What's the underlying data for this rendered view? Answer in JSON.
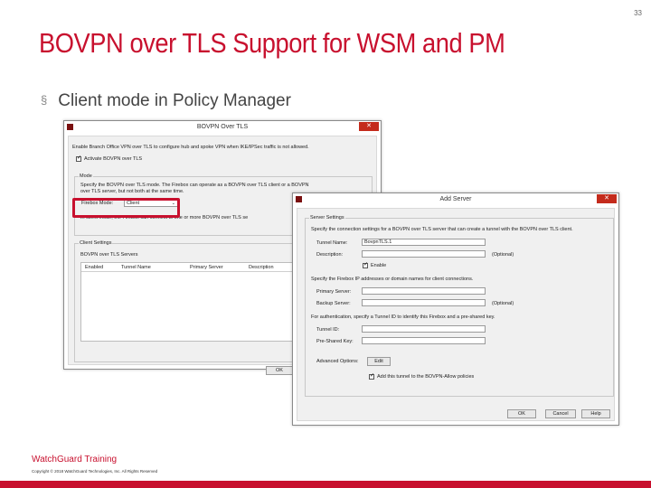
{
  "slide": {
    "number": "33",
    "title": "BOVPN over TLS Support for WSM and PM",
    "bullet_mark": "§",
    "bullet": "Client mode in Policy Manager",
    "footer_brand": "WatchGuard Training",
    "footer_copy": "Copyright © 2018 WatchGuard Technologies, Inc. All Rights Reserved"
  },
  "colors": {
    "accent": "#c8102e",
    "close_button": "#c42b1c"
  },
  "bovpn_dialog": {
    "title": "BOVPN Over TLS",
    "close": "✕",
    "intro": "Enable Branch Office VPN over TLS to configure hub and spoke VPN when IKE/IPSec traffic is not allowed.",
    "activate_label": "Activate BOVPN over TLS",
    "activate_checked": true,
    "mode_group": "Mode",
    "mode_help_1": "Specify the BOVPN over TLS mode. The Firebox can operate as a BOVPN over TLS client or a BOVPN",
    "mode_help_2": "over TLS server, but not both at the same time.",
    "firebox_mode_label": "Firebox Mode:",
    "firebox_mode_value": "Client",
    "client_note": "In client mode, the Firebox can connect to one or more BOVPN over TLS se",
    "client_settings_group": "Client Settings",
    "servers_label": "BOVPN over TLS Servers",
    "table_columns": [
      "Enabled",
      "Tunnel Name",
      "Primary Server",
      "Description"
    ],
    "ok_label": "OK"
  },
  "add_server_dialog": {
    "title": "Add Server",
    "close": "✕",
    "group": "Server Settings",
    "intro": "Specify the connection settings for a BOVPN over TLS server that can create a tunnel with the BOVPN over TLS client.",
    "tunnel_name_label": "Tunnel Name:",
    "tunnel_name_value": "BovpnTLS.1",
    "description_label": "Description:",
    "optional": "(Optional)",
    "enable_label": "Enable",
    "enable_checked": true,
    "address_help": "Specify the Firebox IP addresses or domain names for client connections.",
    "primary_server_label": "Primary Server:",
    "backup_server_label": "Backup Server:",
    "auth_help": "For authentication, specify a Tunnel ID to identify this Firebox and a pre-shared key.",
    "tunnel_id_label": "Tunnel ID:",
    "psk_label": "Pre-Shared Key:",
    "advanced_label": "Advanced Options:",
    "edit_label": "Edit",
    "add_tunnel_label": "Add this tunnel to the BOVPN-Allow policies",
    "add_tunnel_checked": true,
    "ok_label": "OK",
    "cancel_label": "Cancel",
    "help_label": "Help"
  }
}
